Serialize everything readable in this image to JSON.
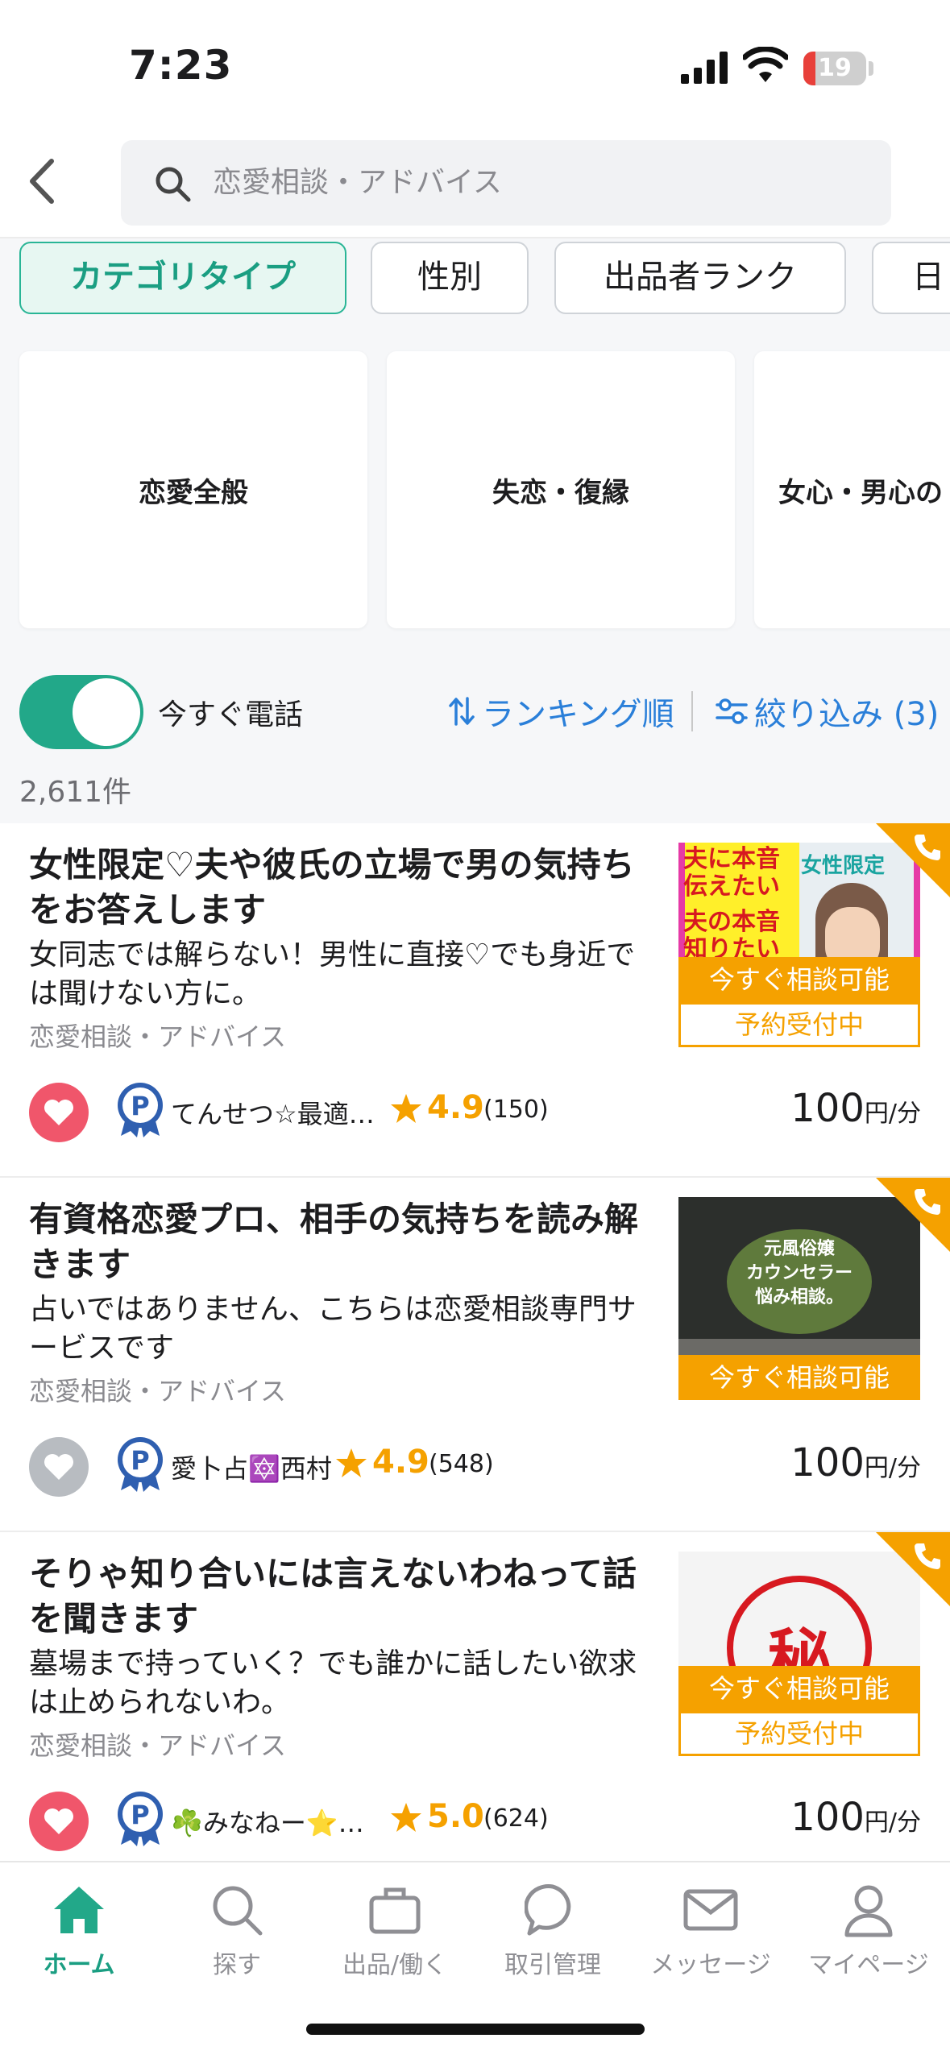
{
  "status_bar": {
    "time": "7:23",
    "battery": "19",
    "battery_level": 0.19
  },
  "search": {
    "query": "恋愛相談・アドバイス"
  },
  "chips": [
    {
      "label": "カテゴリタイプ",
      "active": true
    },
    {
      "label": "性別",
      "active": false
    },
    {
      "label": "出品者ランク",
      "active": false
    },
    {
      "label": "日",
      "active": false
    }
  ],
  "categories": [
    {
      "label": "恋愛全般"
    },
    {
      "label": "失恋・復縁"
    },
    {
      "label": "女心・男心の"
    }
  ],
  "controls": {
    "toggle_label": "今すぐ電話",
    "toggle_on": true,
    "sort_label": "ランキング順",
    "filter_label": "絞り込み (3)",
    "result_count": "2,611件"
  },
  "listings": [
    {
      "title": "女性限定♡夫や彼氏の立場で男の気持ちをお答えします",
      "description": "女同志では解らない！男性に直接♡でも身近では聞けない方に。",
      "category": "恋愛相談・アドバイス",
      "favorited": true,
      "seller": "てんせつ☆最適…",
      "rating": "4.9",
      "review_count": "(150)",
      "price": "100",
      "price_unit": "円/分",
      "status_now": "今すぐ相談可能",
      "status_reserve": "予約受付中",
      "thumb_texts": [
        "夫に本音",
        "伝えたい",
        "夫の本音",
        "知りたい",
        "女性限定"
      ]
    },
    {
      "title": "有資格恋愛プロ、相手の気持ちを読み解きます",
      "description": "占いではありません、こちらは恋愛相談専門サービスです",
      "category": "恋愛相談・アドバイス",
      "favorited": false,
      "seller": "愛卜占🔯西村",
      "rating": "4.9",
      "review_count": "(548)",
      "price": "100",
      "price_unit": "円/分",
      "status_now": "今すぐ相談可能",
      "status_reserve": "",
      "thumb_texts": [
        "元風俗嬢",
        "カウンセラー",
        "悩み相談。"
      ]
    },
    {
      "title": "そりゃ知り合いには言えないわねって話を聞きます",
      "description": "墓場まで持っていく？でも誰かに話したい欲求は止められないわ。",
      "category": "恋愛相談・アドバイス",
      "favorited": true,
      "seller": "☘️みなねー⭐…",
      "rating": "5.0",
      "review_count": "(624)",
      "price": "100",
      "price_unit": "円/分",
      "status_now": "今すぐ相談可能",
      "status_reserve": "予約受付中",
      "thumb_texts": [
        "秘"
      ]
    }
  ],
  "nav": [
    {
      "label": "ホーム",
      "icon": "home-icon",
      "active": true
    },
    {
      "label": "探す",
      "icon": "search-icon",
      "active": false
    },
    {
      "label": "出品/働く",
      "icon": "briefcase-icon",
      "active": false
    },
    {
      "label": "取引管理",
      "icon": "chat-bubble-icon",
      "active": false
    },
    {
      "label": "メッセージ",
      "icon": "mail-icon",
      "active": false
    },
    {
      "label": "マイページ",
      "icon": "person-icon",
      "active": false
    }
  ],
  "colors": {
    "accent": "#22a889",
    "orange": "#f5a100",
    "link": "#2a7fd9",
    "heart": "#f0566b"
  }
}
